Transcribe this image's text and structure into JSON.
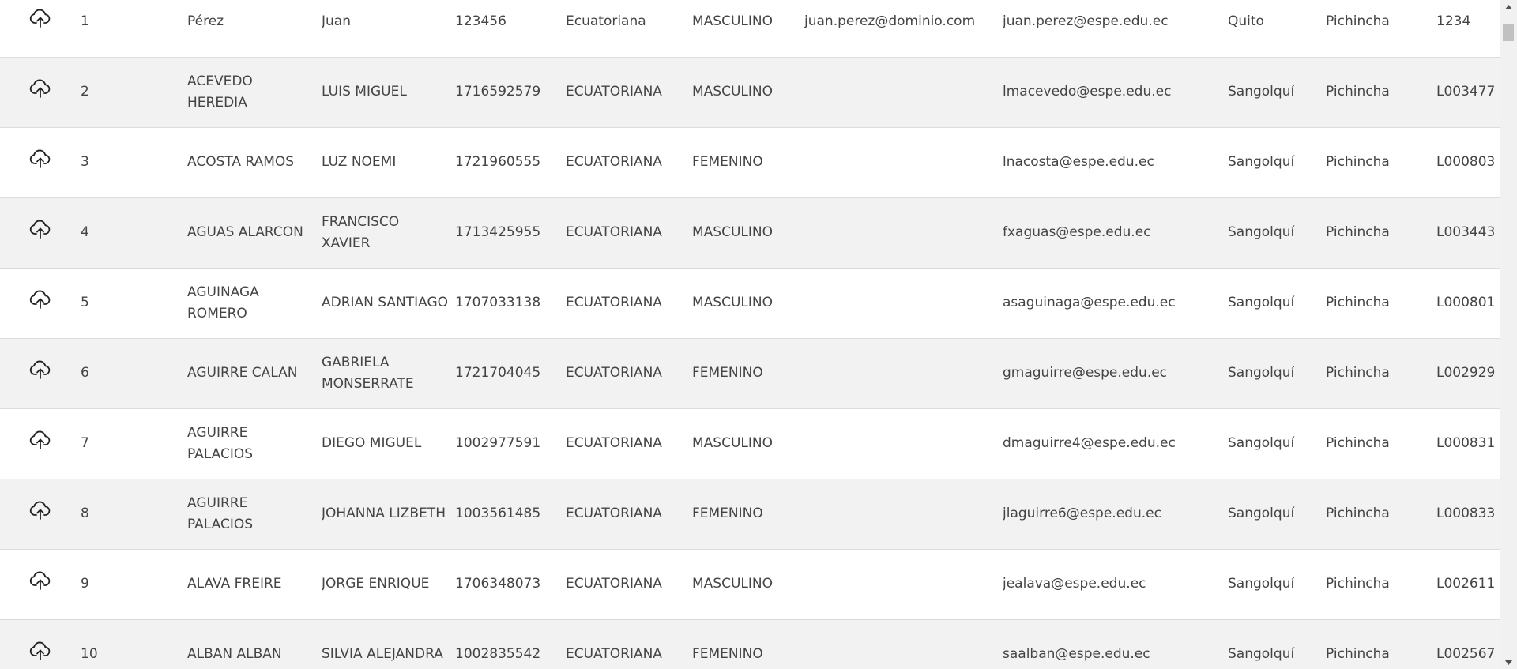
{
  "rows": [
    {
      "idx": "1",
      "apellidos": "Pérez",
      "nombres": "Juan",
      "cedula": "123456",
      "nacionalidad": "Ecuatoriana",
      "genero": "MASCULINO",
      "correo_personal": "juan.perez@dominio.com",
      "correo_inst": "juan.perez@espe.edu.ec",
      "ciudad": "Quito",
      "provincia": "Pichincha",
      "codigo": "1234"
    },
    {
      "idx": "2",
      "apellidos": "ACEVEDO HEREDIA",
      "nombres": "LUIS MIGUEL",
      "cedula": "1716592579",
      "nacionalidad": "ECUATORIANA",
      "genero": "MASCULINO",
      "correo_personal": "",
      "correo_inst": "lmacevedo@espe.edu.ec",
      "ciudad": "Sangolquí",
      "provincia": "Pichincha",
      "codigo": "L003477"
    },
    {
      "idx": "3",
      "apellidos": "ACOSTA RAMOS",
      "nombres": "LUZ NOEMI",
      "cedula": "1721960555",
      "nacionalidad": "ECUATORIANA",
      "genero": "FEMENINO",
      "correo_personal": "",
      "correo_inst": "lnacosta@espe.edu.ec",
      "ciudad": "Sangolquí",
      "provincia": "Pichincha",
      "codigo": "L000803"
    },
    {
      "idx": "4",
      "apellidos": "AGUAS ALARCON",
      "nombres": "FRANCISCO XAVIER",
      "cedula": "1713425955",
      "nacionalidad": "ECUATORIANA",
      "genero": "MASCULINO",
      "correo_personal": "",
      "correo_inst": "fxaguas@espe.edu.ec",
      "ciudad": "Sangolquí",
      "provincia": "Pichincha",
      "codigo": "L003443"
    },
    {
      "idx": "5",
      "apellidos": "AGUINAGA ROMERO",
      "nombres": "ADRIAN SANTIAGO",
      "cedula": "1707033138",
      "nacionalidad": "ECUATORIANA",
      "genero": "MASCULINO",
      "correo_personal": "",
      "correo_inst": "asaguinaga@espe.edu.ec",
      "ciudad": "Sangolquí",
      "provincia": "Pichincha",
      "codigo": "L000801"
    },
    {
      "idx": "6",
      "apellidos": "AGUIRRE CALAN",
      "nombres": "GABRIELA MONSERRATE",
      "cedula": "1721704045",
      "nacionalidad": "ECUATORIANA",
      "genero": "FEMENINO",
      "correo_personal": "",
      "correo_inst": "gmaguirre@espe.edu.ec",
      "ciudad": "Sangolquí",
      "provincia": "Pichincha",
      "codigo": "L002929"
    },
    {
      "idx": "7",
      "apellidos": "AGUIRRE PALACIOS",
      "nombres": "DIEGO MIGUEL",
      "cedula": "1002977591",
      "nacionalidad": "ECUATORIANA",
      "genero": "MASCULINO",
      "correo_personal": "",
      "correo_inst": "dmaguirre4@espe.edu.ec",
      "ciudad": "Sangolquí",
      "provincia": "Pichincha",
      "codigo": "L000831"
    },
    {
      "idx": "8",
      "apellidos": "AGUIRRE PALACIOS",
      "nombres": "JOHANNA LIZBETH",
      "cedula": "1003561485",
      "nacionalidad": "ECUATORIANA",
      "genero": "FEMENINO",
      "correo_personal": "",
      "correo_inst": "jlaguirre6@espe.edu.ec",
      "ciudad": "Sangolquí",
      "provincia": "Pichincha",
      "codigo": "L000833"
    },
    {
      "idx": "9",
      "apellidos": "ALAVA FREIRE",
      "nombres": "JORGE ENRIQUE",
      "cedula": "1706348073",
      "nacionalidad": "ECUATORIANA",
      "genero": "MASCULINO",
      "correo_personal": "",
      "correo_inst": "jealava@espe.edu.ec",
      "ciudad": "Sangolquí",
      "provincia": "Pichincha",
      "codigo": "L002611"
    },
    {
      "idx": "10",
      "apellidos": "ALBAN ALBAN",
      "nombres": "SILVIA ALEJANDRA",
      "cedula": "1002835542",
      "nacionalidad": "ECUATORIANA",
      "genero": "FEMENINO",
      "correo_personal": "",
      "correo_inst": "saalban@espe.edu.ec",
      "ciudad": "Sangolquí",
      "provincia": "Pichincha",
      "codigo": "L002567"
    }
  ],
  "icons": {
    "row_action": "cloud-upload-icon",
    "scroll_up": "triangle-up-icon",
    "scroll_down": "triangle-down-icon"
  },
  "colors": {
    "row_alt": "#f2f2f2",
    "text": "#444444",
    "row_border": "#dcdcdc"
  }
}
